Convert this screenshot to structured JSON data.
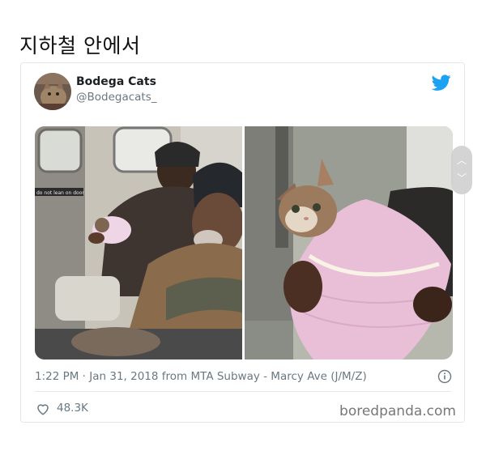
{
  "page": {
    "title": "지하철 안에서"
  },
  "tweet": {
    "display_name": "Bodega Cats",
    "handle": "@Bodegacats_",
    "timestamp": "1:22 PM · Jan 31, 2018 from MTA Subway - Marcy Ave (J/M/Z)",
    "like_count": "48.3K",
    "sign_text": "do not lean on door"
  },
  "watermark": "boredpanda.com",
  "colors": {
    "twitter_blue": "#1da1f2",
    "meta_gray": "#697882",
    "border": "#e1e8ed"
  },
  "icons": {
    "bird": "twitter-bird-icon",
    "info": "info-icon",
    "like": "heart-icon",
    "scroll_up": "chevron-up-icon",
    "scroll_down": "chevron-down-icon"
  }
}
